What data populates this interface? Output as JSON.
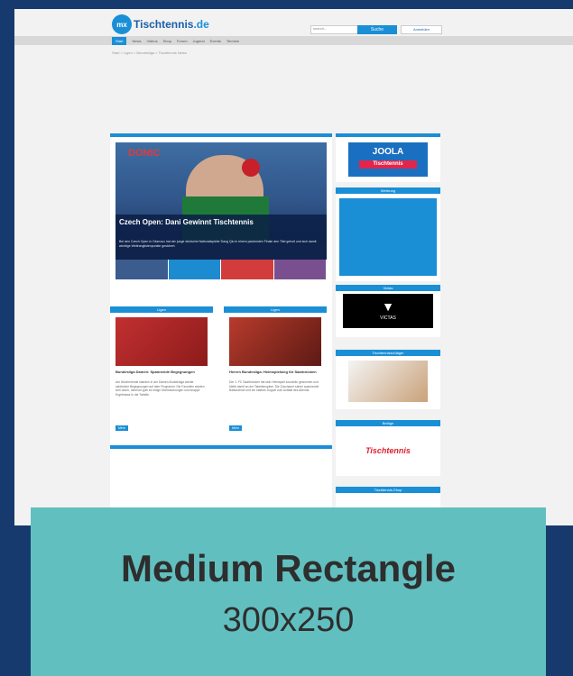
{
  "site": {
    "logo_badge": "mx",
    "logo_text": "Tischtennis",
    "logo_ext": ".de",
    "search_placeholder": "search...",
    "search_button": "Suche",
    "login": "Anmelden",
    "nav": [
      "Start",
      "News",
      "Videos",
      "Shop",
      "Forum",
      "Jugend",
      "Events",
      "Termine"
    ],
    "breadcrumb": "Start > Ligen > Bundesliga > Tischtennis News"
  },
  "main": {
    "hero": {
      "brand": "DONIC",
      "title": "Czech Open: Dani Gewinnt Tischtennis",
      "description": "Bei den Czech Open in Olomouc hat der junge deutsche Nationalspieler Dang Qiu in einem packenden Finale den Titel geholt und sich damit wichtige Weltranglistenpunkte gesichert."
    },
    "cards": [
      {
        "head": "Ligen",
        "title": "Bundesliga Damen: Spannende Begegnungen",
        "text": "Am Wochenende standen in der Damen-Bundesliga wieder zahlreiche Begegnungen auf dem Programm. Die Favoriten setzten sich durch, dennoch gab es einige Überraschungen und knappe Ergebnisse in der Tabelle.",
        "button": "Mehr"
      },
      {
        "head": "Ligen",
        "title": "Herren Bundesliga: Heimspielsieg für Saarbrücken",
        "text": "Der 1. FC Saarbrücken hat sein Heimspiel souverän gewonnen und bleibt damit an der Tabellenspitze. Die Zuschauer sahen spannende Ballwechsel und ein starkes Doppel zum Auftakt des Abends.",
        "button": "Mehr"
      }
    ]
  },
  "sidebar": {
    "joola_logo": "JOOLA",
    "joola_sub": "Tischtennis",
    "widget_head_1": "Werbung",
    "widget_head_2": "Victas",
    "victas_text": "VICTAS",
    "widget_head_3": "Tischtennisschläger",
    "widget_head_4": "Beläge",
    "rubber_text": "Tischtennis",
    "widget_head_5": "Tischtennis-Shop"
  },
  "caption": {
    "title": "Medium Rectangle",
    "size": "300x250"
  }
}
